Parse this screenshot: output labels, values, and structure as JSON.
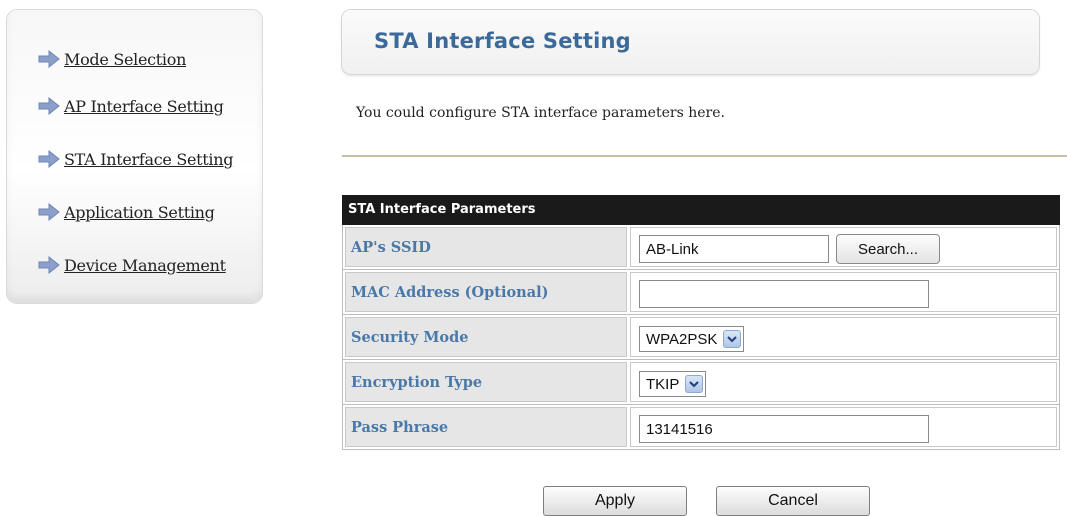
{
  "sidebar": {
    "items": [
      {
        "label": "Mode Selection",
        "icon": "arrow-right-icon"
      },
      {
        "label": "AP Interface Setting",
        "icon": "arrow-right-icon"
      },
      {
        "label": "STA Interface Setting",
        "icon": "arrow-right-icon"
      },
      {
        "label": "Application Setting",
        "icon": "arrow-right-icon"
      },
      {
        "label": "Device Management",
        "icon": "arrow-right-icon"
      }
    ]
  },
  "page": {
    "title": "STA Interface Setting",
    "description": "You could configure STA interface parameters here."
  },
  "table": {
    "header": "STA Interface Parameters",
    "rows": {
      "ssid": {
        "label": "AP's SSID",
        "value": "AB-Link",
        "button": "Search..."
      },
      "mac": {
        "label": "MAC Address (Optional)",
        "value": ""
      },
      "security": {
        "label": "Security Mode",
        "value": "WPA2PSK"
      },
      "encryption": {
        "label": "Encryption Type",
        "value": "TKIP"
      },
      "passphrase": {
        "label": "Pass Phrase",
        "value": "13141516"
      }
    }
  },
  "actions": {
    "apply_label": "Apply",
    "cancel_label": "Cancel"
  },
  "colors": {
    "title": "#3b6a9a",
    "row_label": "#4a78a8",
    "table_header_bg": "#1a1a1a",
    "arrow": "#8a9fc9"
  }
}
